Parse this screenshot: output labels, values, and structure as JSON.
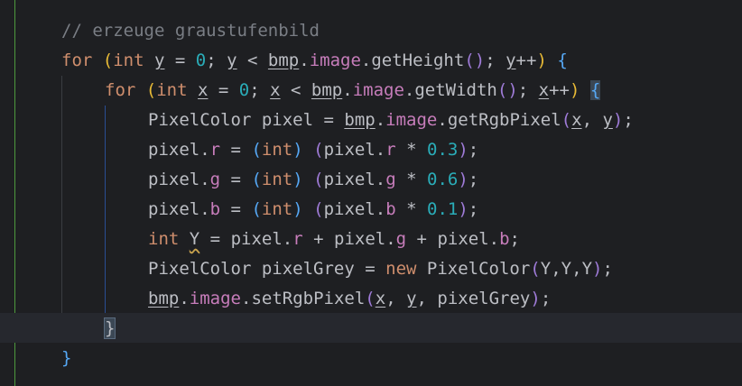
{
  "editor": {
    "comment": "// erzeuge graustufenbild",
    "kw_for": "for",
    "kw_int": "int",
    "kw_new": "new",
    "var_y": "y",
    "var_x": "x",
    "var_Y": "Y",
    "var_pixel": "pixel",
    "var_pixelGrey": "pixelGrey",
    "bmp": "bmp",
    "image": "image",
    "type_PixelColor": "PixelColor",
    "m_getHeight": "getHeight",
    "m_getWidth": "getWidth",
    "m_getRgbPixel": "getRgbPixel",
    "m_setRgbPixel": "setRgbPixel",
    "ctor_PixelColor": "PixelColor",
    "f_r": "r",
    "f_g": "g",
    "f_b": "b",
    "zero": "0",
    "c_r": "0.3",
    "c_g": "0.6",
    "c_b": "0.1",
    "close_inner": "}",
    "close_outer": "}"
  },
  "colors": {
    "background": "#1e1f22",
    "keyword": "#cf8e6d",
    "comment": "#7a7e85",
    "number": "#2aacb8",
    "field": "#c77dbb",
    "text": "#bcbec4",
    "paren_level1": "#e8ba36",
    "paren_level2": "#9f7bd8",
    "paren_level3": "#56a8f5",
    "vcs_gutter": "#4e9a3e"
  }
}
